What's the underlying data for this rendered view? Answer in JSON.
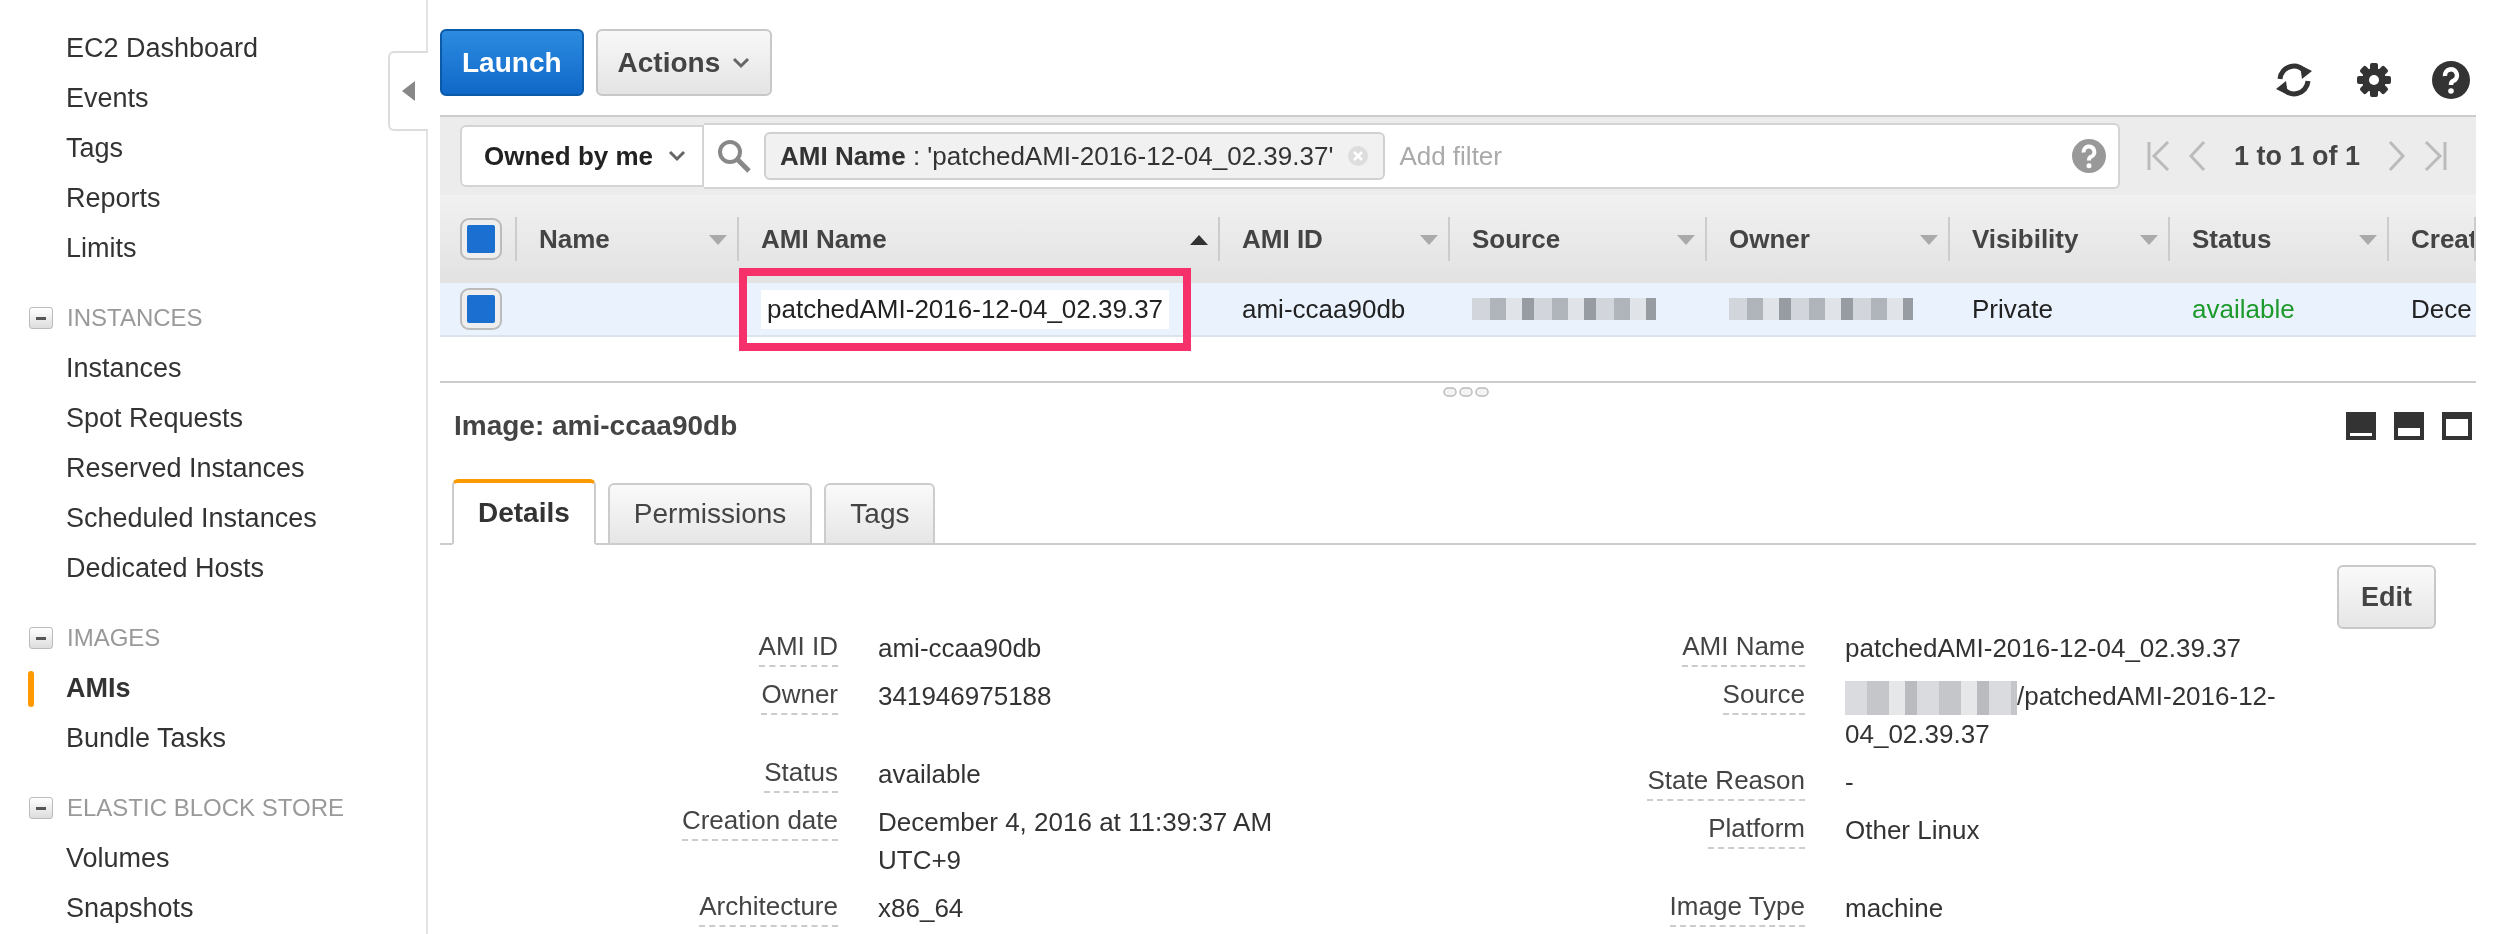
{
  "sidebar": {
    "items": [
      {
        "label": "EC2 Dashboard",
        "selected": false
      },
      {
        "label": "Events",
        "selected": false
      },
      {
        "label": "Tags",
        "selected": false
      },
      {
        "label": "Reports",
        "selected": false
      },
      {
        "label": "Limits",
        "selected": false
      }
    ],
    "sections": [
      {
        "title": "INSTANCES",
        "expanded": true,
        "items": [
          {
            "label": "Instances",
            "selected": false
          },
          {
            "label": "Spot Requests",
            "selected": false
          },
          {
            "label": "Reserved Instances",
            "selected": false
          },
          {
            "label": "Scheduled Instances",
            "selected": false
          },
          {
            "label": "Dedicated Hosts",
            "selected": false
          }
        ]
      },
      {
        "title": "IMAGES",
        "expanded": true,
        "items": [
          {
            "label": "AMIs",
            "selected": true
          },
          {
            "label": "Bundle Tasks",
            "selected": false
          }
        ]
      },
      {
        "title": "ELASTIC BLOCK STORE",
        "expanded": true,
        "items": [
          {
            "label": "Volumes",
            "selected": false
          },
          {
            "label": "Snapshots",
            "selected": false
          }
        ]
      }
    ]
  },
  "toolbar": {
    "buttons": [
      {
        "label": "Launch",
        "kind": "primary"
      },
      {
        "label": "Actions",
        "kind": "dropdown"
      }
    ]
  },
  "filter": {
    "owner_filter": "Owned by me",
    "token": "**AMI Name** : 'patchedAMI-2016-12-04_02.39.37'",
    "placeholder": "Add filter",
    "pagination": "1 to 1 of 1"
  },
  "table": {
    "header_checked": true,
    "columns": [
      {
        "label": "Name",
        "sorted": false
      },
      {
        "label": "AMI Name",
        "sorted": true
      },
      {
        "label": "AMI ID",
        "sorted": false
      },
      {
        "label": "Source",
        "sorted": false
      },
      {
        "label": "Owner",
        "sorted": false
      },
      {
        "label": "Visibility",
        "sorted": false
      },
      {
        "label": "Status",
        "sorted": false
      },
      {
        "label": "Creat"
      }
    ],
    "rows": [
      {
        "selected": true,
        "checked": true,
        "cells": [
          {
            "kind": "empty"
          },
          {
            "kind": "text",
            "text": "patchedAMI-2016-12-04_02.39.37",
            "highlighted": true
          },
          {
            "kind": "text",
            "text": "ami-ccaa90db"
          },
          {
            "kind": "redacted"
          },
          {
            "kind": "redacted"
          },
          {
            "kind": "text",
            "text": "Private"
          },
          {
            "kind": "status",
            "text": "available"
          },
          {
            "kind": "text",
            "text": "Dece"
          }
        ]
      }
    ]
  },
  "details": {
    "title": "Image: ami-ccaa90db",
    "tabs": [
      {
        "label": "Details",
        "selected": true
      },
      {
        "label": "Permissions",
        "selected": false
      },
      {
        "label": "Tags",
        "selected": false
      }
    ],
    "edit_button": "Edit",
    "columns": [
      {
        "groups": [
          [
            {
              "label": "AMI ID",
              "value": "ami-ccaa90db"
            },
            {
              "label": "Owner",
              "value": "341946975188"
            }
          ],
          [
            {
              "label": "Status",
              "value": "available"
            },
            {
              "label": "Creation date",
              "value": "December 4, 2016 at 11:39:37 AM UTC+9"
            },
            {
              "label": "Architecture",
              "value": "x86_64"
            }
          ]
        ]
      },
      {
        "groups": [
          [
            {
              "label": "AMI Name",
              "value": "patchedAMI-2016-12-04_02.39.37"
            },
            {
              "label": "Source",
              "value": "/patchedAMI-2016-12-04_02.39.37",
              "redacted": true
            },
            {
              "label": "State Reason",
              "value": "-"
            },
            {
              "label": "Platform",
              "value": "Other Linux"
            }
          ],
          [
            {
              "label": "Image Type",
              "value": "machine"
            }
          ]
        ]
      }
    ]
  }
}
